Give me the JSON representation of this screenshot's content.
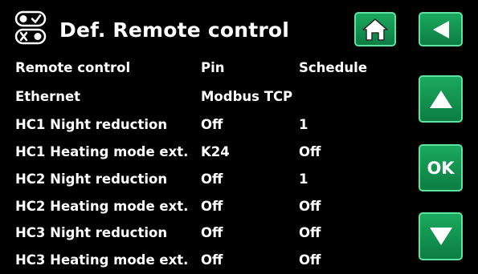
{
  "header": {
    "title": "Def. Remote control",
    "icon": "toggle-switches-icon"
  },
  "nav": {
    "home_icon": "home-icon",
    "back_icon": "back-arrow-icon",
    "up_icon": "up-arrow-icon",
    "ok_label": "OK",
    "down_icon": "down-arrow-icon"
  },
  "table": {
    "rows": [
      [
        "Remote control",
        "Pin",
        "Schedule"
      ],
      [
        "Ethernet",
        "Modbus TCP",
        ""
      ],
      [
        "HC1 Night reduction",
        "Off",
        "1"
      ],
      [
        "HC1 Heating mode ext.",
        "K24",
        "Off"
      ],
      [
        "HC2 Night reduction",
        "Off",
        "1"
      ],
      [
        "HC2 Heating mode ext.",
        "Off",
        "Off"
      ],
      [
        "HC3 Night reduction",
        "Off",
        "Off"
      ],
      [
        "HC3 Heating mode ext.",
        "Off",
        "Off"
      ]
    ]
  },
  "colors": {
    "background": "#000000",
    "text": "#ffffff",
    "button": "#14995a",
    "button_border": "#5fe1a0"
  }
}
